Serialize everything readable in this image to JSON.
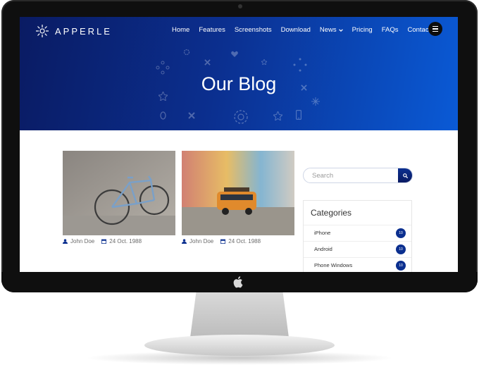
{
  "brand": {
    "name": "APPERLE"
  },
  "nav": {
    "items": [
      {
        "label": "Home"
      },
      {
        "label": "Features"
      },
      {
        "label": "Screenshots"
      },
      {
        "label": "Download"
      },
      {
        "label": "News",
        "has_dropdown": true
      },
      {
        "label": "Pricing"
      },
      {
        "label": "FAQs"
      },
      {
        "label": "Contact"
      }
    ]
  },
  "hero": {
    "title": "Our Blog"
  },
  "posts": [
    {
      "author": "John Doe",
      "date": "24 Oct. 1988"
    },
    {
      "author": "John Doe",
      "date": "24 Oct. 1988"
    }
  ],
  "sidebar": {
    "search": {
      "placeholder": "Search"
    },
    "categories": {
      "title": "Categories",
      "items": [
        {
          "label": "iPhone",
          "count": "10"
        },
        {
          "label": "Android",
          "count": "10"
        },
        {
          "label": "Phone Windows",
          "count": "10"
        }
      ]
    }
  },
  "colors": {
    "hero_start": "#0a1b63",
    "hero_end": "#0a5ad6",
    "accent": "#0b2f8f"
  },
  "icons": [
    "logo-icon",
    "chevron-down-icon",
    "menu-icon",
    "gear-icon",
    "user-icon",
    "calendar-icon",
    "search-icon",
    "apple-icon"
  ]
}
